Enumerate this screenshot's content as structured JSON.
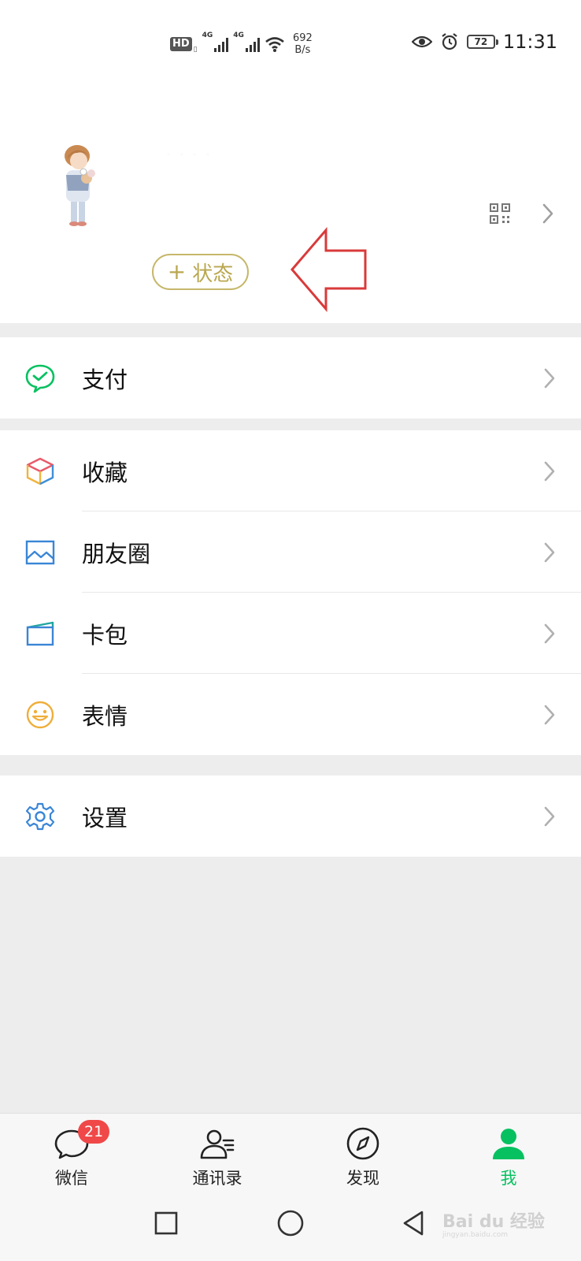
{
  "status_bar": {
    "hd_label": "HD",
    "network_1": "4G",
    "network_2": "4G",
    "speed_value": "692",
    "speed_unit": "B/s",
    "battery": "72",
    "time": "11:31"
  },
  "profile": {
    "nickname": "·  ·  ·  ·",
    "status_plus": "+",
    "status_label": "状态"
  },
  "menu": {
    "pay": "支付",
    "favorites": "收藏",
    "moments": "朋友圈",
    "card_wallet": "卡包",
    "stickers": "表情",
    "settings": "设置"
  },
  "tabs": {
    "chats": "微信",
    "chats_badge": "21",
    "contacts": "通讯录",
    "discover": "发现",
    "me": "我"
  },
  "colors": {
    "accent_green": "#07c160",
    "status_gold": "#c6b76a",
    "annotation_red": "#d93a3a",
    "badge_red": "#f04848"
  },
  "watermark": {
    "brand": "Bai du 经验",
    "url": "jingyan.baidu.com"
  }
}
